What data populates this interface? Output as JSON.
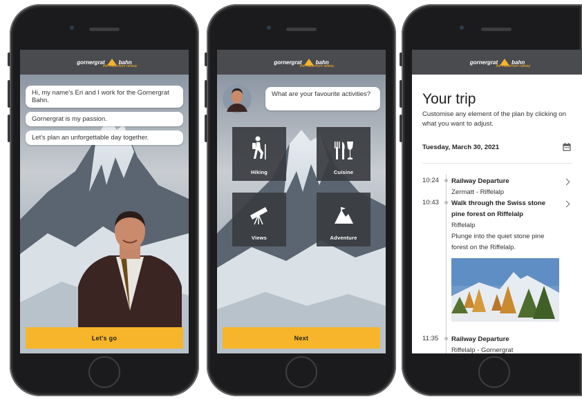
{
  "brand": {
    "word1": "gornergrat",
    "word2": "bahn",
    "tagline": "the matterhorn railway"
  },
  "screen1": {
    "messages": [
      "Hi, my name's Eri and I work for the Gornergrat Bahn.",
      "Gornergrat is my passion.",
      "Let's plan an unforgettable day together."
    ],
    "cta_label": "Let's go"
  },
  "screen2": {
    "question": "What are your favourite activities?",
    "activities": [
      "Hiking",
      "Cuisine",
      "Views",
      "Adventure"
    ],
    "cta_label": "Next"
  },
  "screen3": {
    "title": "Your trip",
    "subtitle": "Customise any element of the plan by clicking on what you want to adjust.",
    "date": "Tuesday, March 30, 2021",
    "events": [
      {
        "time": "10:24",
        "title": "Railway Departure",
        "detail": "Zermatt - Riffelalp"
      },
      {
        "time": "10:43",
        "title": "Walk through the Swiss stone pine forest on Riffelalp",
        "detail": "Riffelalp",
        "description": "Plunge into the quiet stone pine forest on the Riffelalp."
      },
      {
        "time": "11:35",
        "title": "Railway Departure",
        "detail": "Riffelalp - Gornergrat"
      }
    ]
  },
  "colors": {
    "accent": "#f6b52a",
    "topbar": "#4a4b4e",
    "tile": "#3a3c40"
  }
}
